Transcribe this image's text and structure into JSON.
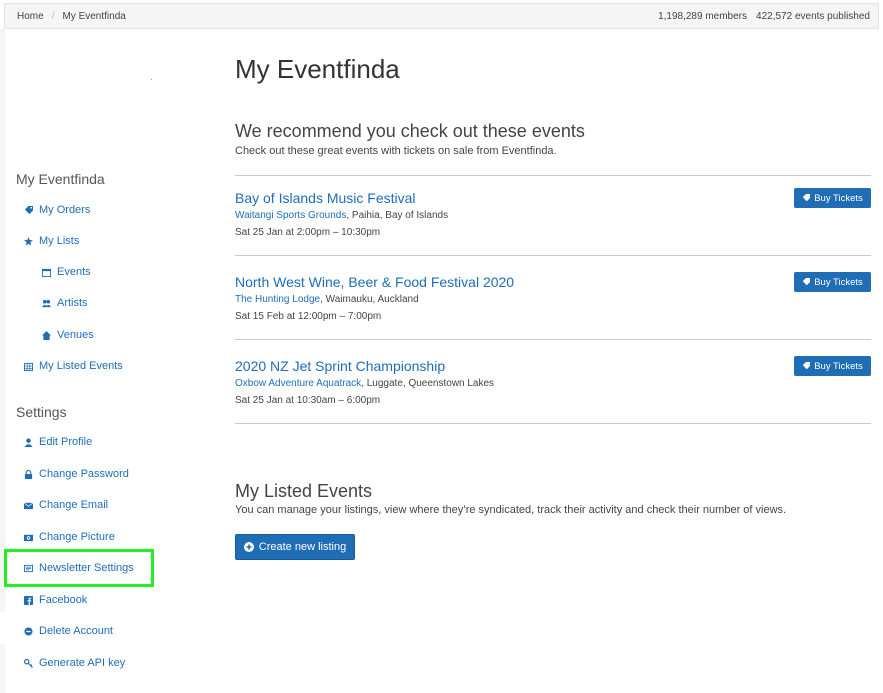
{
  "breadcrumb": {
    "home": "Home",
    "separator": "/",
    "current": "My Eventfinda"
  },
  "stats": {
    "members": "1,198,289 members",
    "events": "422,572 events published"
  },
  "sidebar": {
    "section_account": "My Eventfinda",
    "account_items": [
      {
        "label": "My Orders",
        "icon": "tag-icon"
      },
      {
        "label": "My Lists",
        "icon": "star-icon"
      },
      {
        "label": "Events",
        "icon": "calendar-icon"
      },
      {
        "label": "Artists",
        "icon": "users-icon"
      },
      {
        "label": "Venues",
        "icon": "home-icon"
      },
      {
        "label": "My Listed Events",
        "icon": "calendar-grid-icon"
      }
    ],
    "section_settings": "Settings",
    "settings_items": [
      {
        "label": "Edit Profile",
        "icon": "user-icon"
      },
      {
        "label": "Change Password",
        "icon": "lock-icon"
      },
      {
        "label": "Change Email",
        "icon": "envelope-icon"
      },
      {
        "label": "Change Picture",
        "icon": "camera-icon"
      },
      {
        "label": "Newsletter Settings",
        "icon": "newspaper-icon"
      },
      {
        "label": "Facebook",
        "icon": "facebook-icon"
      },
      {
        "label": "Delete Account",
        "icon": "minus-circle-icon"
      },
      {
        "label": "Generate API key",
        "icon": "key-icon"
      }
    ]
  },
  "main": {
    "title": "My Eventfinda",
    "recommend_title": "We recommend you check out these events",
    "recommend_subtitle": "Check out these great events with tickets on sale from Eventfinda.",
    "events": [
      {
        "name": "Bay of Islands Music Festival",
        "venue": "Waitangi Sports Grounds",
        "location": ", Paihia, Bay of Islands",
        "date": "Sat 25 Jan at 2:00pm – 10:30pm",
        "button": "Buy Tickets"
      },
      {
        "name": "North West Wine, Beer & Food Festival 2020",
        "venue": "The Hunting Lodge",
        "location": ", Waimauku, Auckland",
        "date": "Sat 15 Feb at 12:00pm – 7:00pm",
        "button": "Buy Tickets"
      },
      {
        "name": "2020 NZ Jet Sprint Championship",
        "venue": "Oxbow Adventure Aquatrack",
        "location": ", Luggate, Queenstown Lakes",
        "date": "Sat 25 Jan at 10:30am – 6:00pm",
        "button": "Buy Tickets"
      }
    ],
    "listed_title": "My Listed Events",
    "listed_subtitle": "You can manage your listings, view where they’re syndicated, track their activity and check their number of views.",
    "create_button": "Create new listing"
  },
  "colors": {
    "link": "#1f6eb5",
    "button": "#1f6eb5",
    "highlight": "#22ee22"
  }
}
